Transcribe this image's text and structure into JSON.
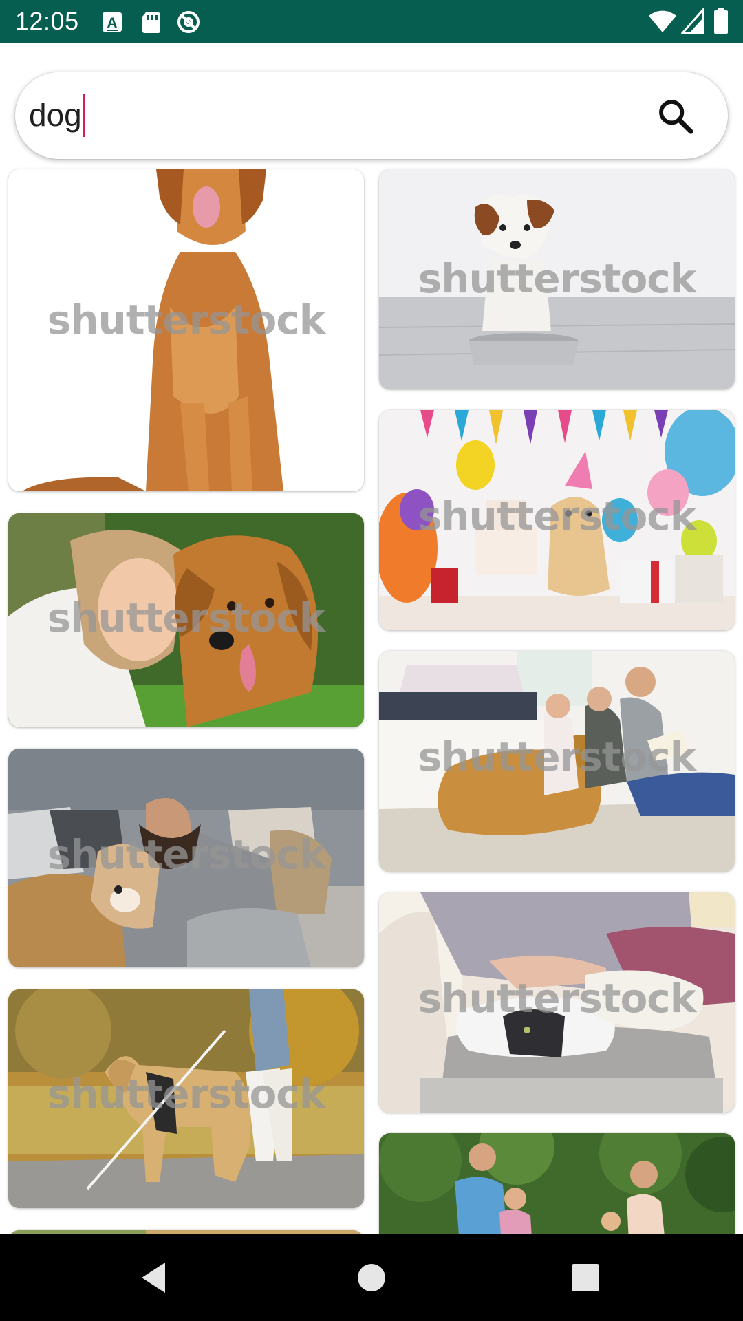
{
  "status_bar": {
    "time": "12:05",
    "background": "#055e4f",
    "left_icons": [
      "keyboard-a-icon",
      "sd-card-icon",
      "at-sign-icon"
    ],
    "right_icons": [
      "wifi-icon",
      "cellular-signal-icon",
      "battery-icon"
    ]
  },
  "search": {
    "query": "dog",
    "caret_color": "#d81b60",
    "button_icon": "search-icon"
  },
  "results": {
    "watermark": "shutterstock",
    "left_column": [
      {
        "subject": "golden retriever sitting on white background"
      },
      {
        "subject": "woman hugging golden retriever on grass"
      },
      {
        "subject": "man hugging dog on sofa"
      },
      {
        "subject": "guide dog walking with person in park"
      },
      {
        "subject": "partial image"
      }
    ],
    "right_column": [
      {
        "subject": "jack russell puppy with food bowl"
      },
      {
        "subject": "dog at birthday party with balloons and cake"
      },
      {
        "subject": "family reading with golden retriever on floor"
      },
      {
        "subject": "cat lying on sofa being petted"
      },
      {
        "subject": "family running in park"
      }
    ]
  },
  "nav_bar": {
    "buttons": [
      "back-icon",
      "home-icon",
      "recents-icon"
    ]
  }
}
